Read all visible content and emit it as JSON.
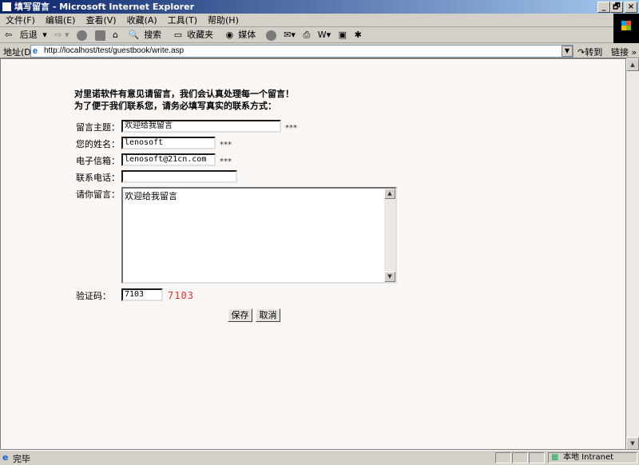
{
  "window": {
    "title": "填写留言 - Microsoft Internet Explorer",
    "minimize": "_",
    "restore": "🗗",
    "close": "×"
  },
  "menu": [
    "文件(F)",
    "编辑(E)",
    "查看(V)",
    "收藏(A)",
    "工具(T)",
    "帮助(H)"
  ],
  "toolbar": {
    "back": "后退",
    "search": "搜索",
    "favorites": "收藏夹",
    "media": "媒体"
  },
  "address": {
    "label": "地址(D)",
    "url": "http://localhost/test/guestbook/write.asp",
    "go": "转到",
    "links": "链接 »"
  },
  "form": {
    "heading1": "对里诺软件有意见请留言，我们会认真处理每一个留言！",
    "heading2": "为了便于我们联系您，请务必填写真实的联系方式：",
    "subject": {
      "label": "留言主题：",
      "value": "欢迎给我留言",
      "required": "***"
    },
    "name": {
      "label": "您的姓名：",
      "value": "lenosoft",
      "required": "***"
    },
    "email": {
      "label": "电子信箱：",
      "value": "lenosoft@21cn.com",
      "required": "***"
    },
    "phone": {
      "label": "联系电话：",
      "value": ""
    },
    "message": {
      "label": "请你留言：",
      "value": "欢迎给我留言"
    },
    "captcha": {
      "label": "验证码：",
      "value": "7103",
      "image_text": "7103"
    },
    "save": "保存",
    "cancel": "取消"
  },
  "status": {
    "text": "完毕",
    "zone": "本地 Intranet"
  }
}
